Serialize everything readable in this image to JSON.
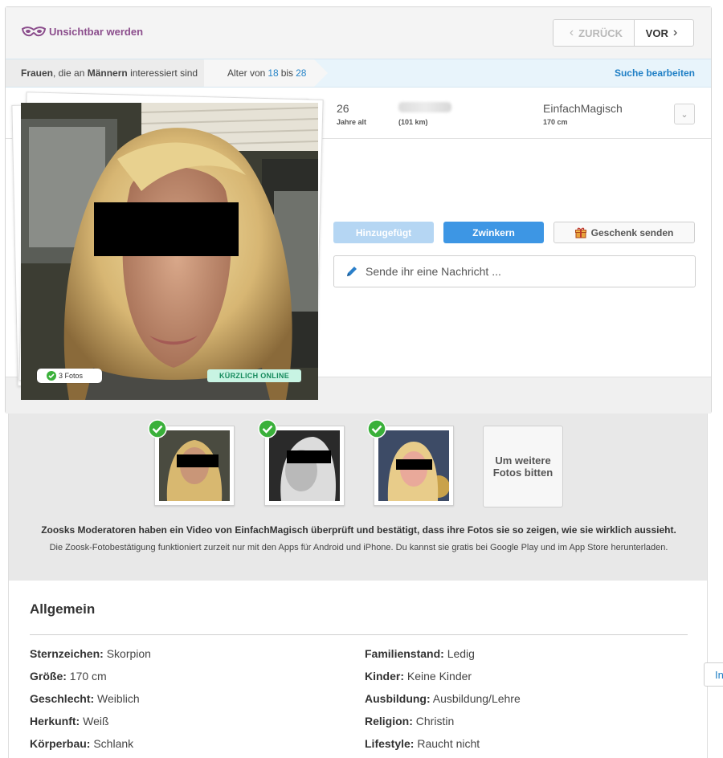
{
  "header": {
    "invisible_label": "Unsichtbar werden",
    "back_label": "ZURÜCK",
    "next_label": "VOR"
  },
  "filter": {
    "crumb1_prefix": "Frauen",
    "crumb1_mid": ", die an ",
    "crumb1_bold": "Männern",
    "crumb1_suffix": " interessiert sind",
    "age_prefix": "Alter von",
    "age_from": "18",
    "age_mid": "bis",
    "age_to": "28",
    "edit_search": "Suche bearbeiten"
  },
  "profile": {
    "age": "26",
    "age_label": "Jahre alt",
    "distance_label": "(101 km)",
    "username": "EinfachMagisch",
    "height": "170 cm"
  },
  "actions": {
    "added_label": "Hinzugefügt",
    "wink_label": "Zwinkern",
    "gift_label": "Geschenk senden",
    "message_placeholder": "Sende ihr eine Nachricht ..."
  },
  "photo": {
    "photo_count_label": "3 Fotos",
    "online_label": "KÜRZLICH ONLINE"
  },
  "verification": {
    "more_photos_label": "Um weitere Fotos bitten",
    "line1": "Zoosks Moderatoren haben ein Video von EinfachMagisch überprüft und bestätigt, dass ihre Fotos sie so zeigen, wie sie wirklich aussieht.",
    "line2": "Die Zoosk-Fotobestätigung funktioniert zurzeit nur mit den Apps für Android und iPhone. Du kannst sie gratis bei Google Play und im App Store herunterladen."
  },
  "details": {
    "heading": "Allgemein",
    "left": [
      {
        "key": "Sternzeichen:",
        "value": "Skorpion"
      },
      {
        "key": "Größe:",
        "value": "170 cm"
      },
      {
        "key": "Geschlecht:",
        "value": "Weiblich"
      },
      {
        "key": "Herkunft:",
        "value": "Weiß"
      },
      {
        "key": "Körperbau:",
        "value": "Schlank"
      }
    ],
    "right": [
      {
        "key": "Familienstand:",
        "value": "Ledig"
      },
      {
        "key": "Kinder:",
        "value": "Keine Kinder"
      },
      {
        "key": "Ausbildung:",
        "value": "Ausbildung/Lehre"
      },
      {
        "key": "Religion:",
        "value": "Christin"
      },
      {
        "key": "Lifestyle:",
        "value": "Raucht nicht"
      }
    ]
  },
  "side_tab_label": "In",
  "colors": {
    "accent_purple": "#8b4d8c",
    "link_blue": "#1f7fc5",
    "wink_blue": "#3d96e4",
    "online_green": "#168a5c",
    "check_green": "#3ab03a"
  }
}
